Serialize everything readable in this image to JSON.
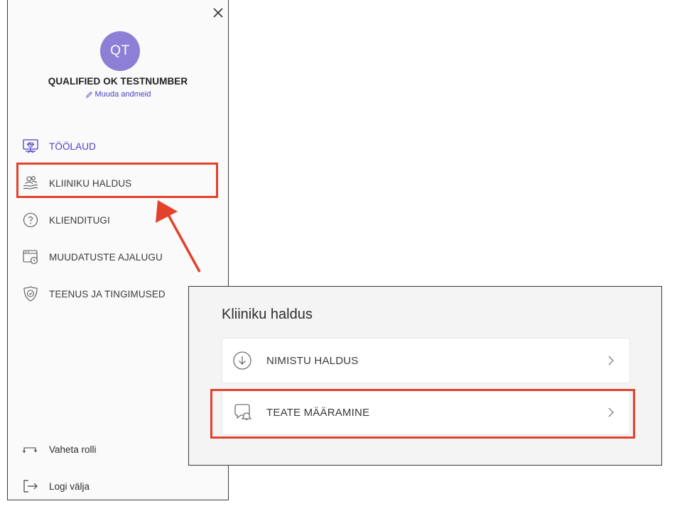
{
  "profile": {
    "initials": "QT",
    "name": "QUALIFIED OK TESTNUMBER",
    "edit_label": "Muuda andmeid"
  },
  "nav": [
    {
      "label": "TÖÖLAUD",
      "icon": "dashboard-icon",
      "active": true
    },
    {
      "label": "KLIINIKU HALDUS",
      "icon": "clinic-management-icon",
      "active": false
    },
    {
      "label": "KLIENDITUGI",
      "icon": "help-icon",
      "active": false
    },
    {
      "label": "MUUDATUSTE AJALUGU",
      "icon": "history-icon",
      "active": false
    },
    {
      "label": "TEENUS JA TINGIMUSED",
      "icon": "shield-check-icon",
      "active": false
    }
  ],
  "footer": {
    "switch_role": "Vaheta rolli",
    "logout": "Logi välja"
  },
  "card": {
    "title": "Kliiniku haldus",
    "items": [
      {
        "label": "NIMISTU HALDUS",
        "icon": "download-circle-icon"
      },
      {
        "label": "TEATE MÄÄRAMINE",
        "icon": "notification-bubble-icon"
      }
    ]
  },
  "colors": {
    "accent": "#4a3fc4",
    "avatar": "#8d7fd6",
    "highlight": "#e2412c"
  }
}
